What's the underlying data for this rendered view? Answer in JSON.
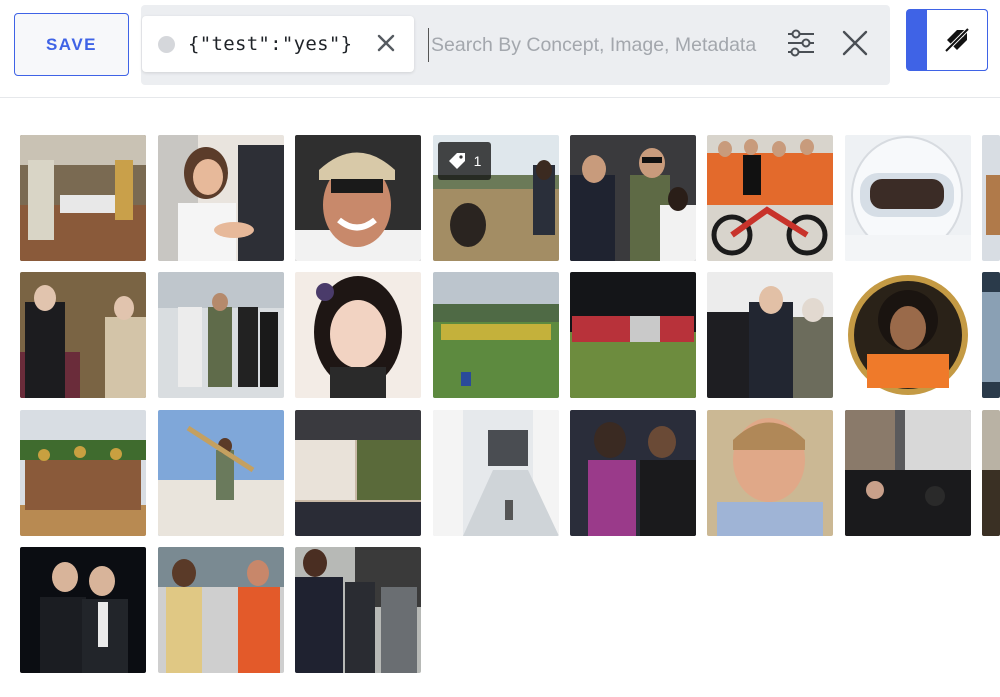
{
  "toolbar": {
    "save_label": "SAVE"
  },
  "search": {
    "chip_text": "{\"test\":\"yes\"}",
    "placeholder": "Search By Concept, Image, Metadata"
  },
  "icons": {
    "filter": "sliders-icon",
    "clear": "close-icon",
    "mode": "tag-slash-icon",
    "chip_remove": "close-icon",
    "tag": "tag-icon"
  },
  "colors": {
    "accent": "#3f63e6"
  },
  "grid": {
    "tagged_count": "1"
  }
}
